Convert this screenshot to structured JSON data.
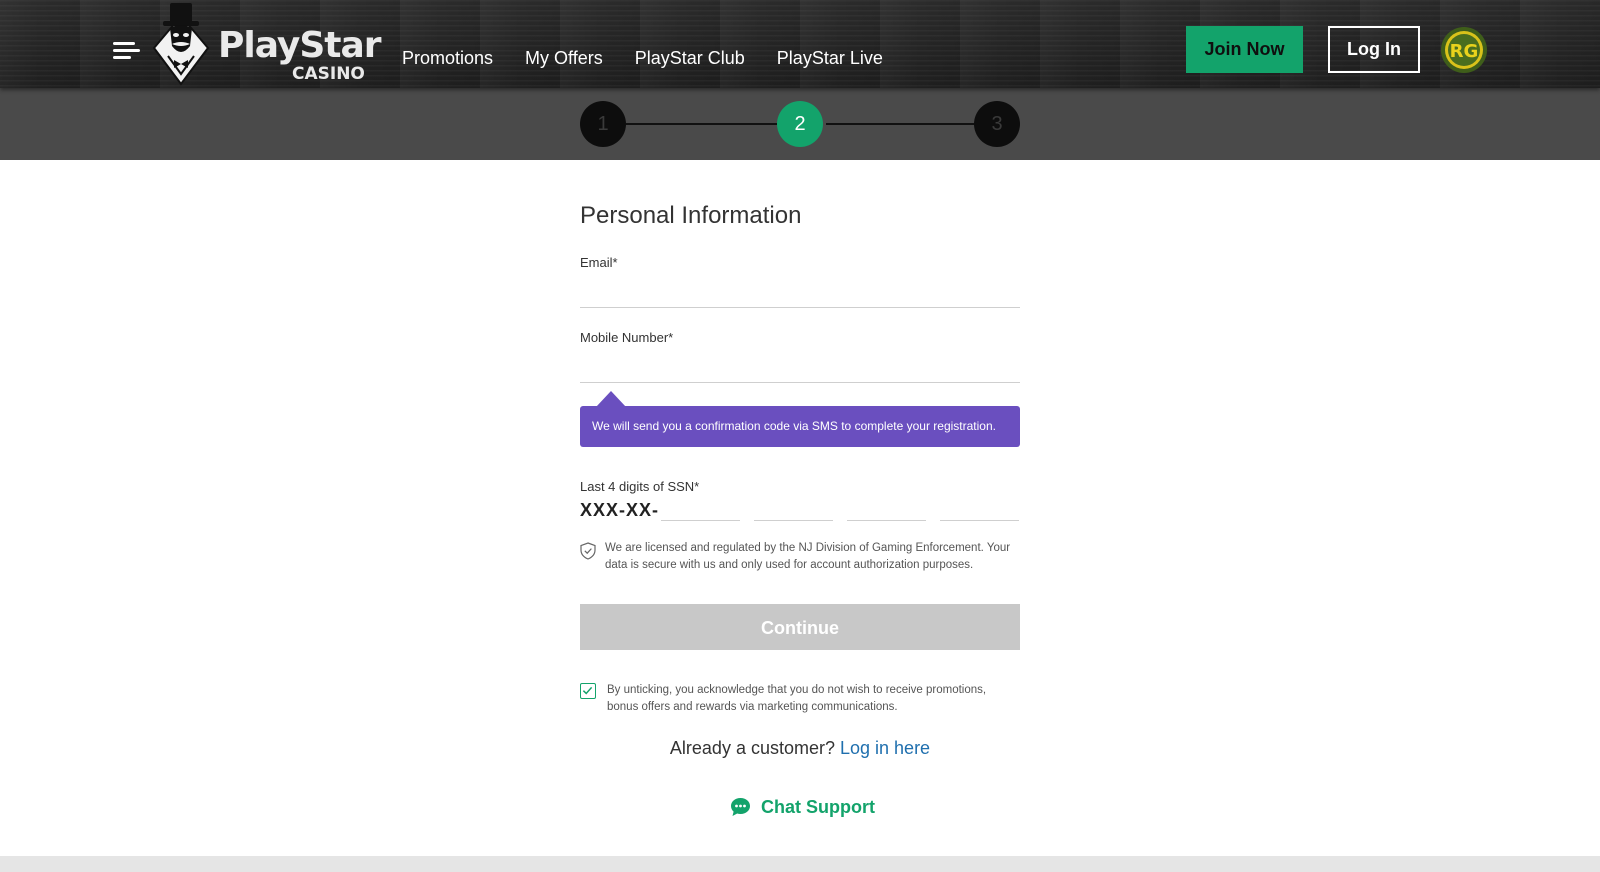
{
  "header": {
    "logo": {
      "word": "PlayStar",
      "sub": "CASINO"
    },
    "nav": [
      {
        "label": "Promotions"
      },
      {
        "label": "My Offers"
      },
      {
        "label": "PlayStar Club"
      },
      {
        "label": "PlayStar Live"
      }
    ],
    "join_label": "Join Now",
    "login_label": "Log In",
    "rg_badge": "RG",
    "colors": {
      "brand_green": "#13a36b",
      "tooltip_purple": "#6a4fbf",
      "link_blue": "#1f6fae"
    }
  },
  "stepper": {
    "steps": [
      "1",
      "2",
      "3"
    ],
    "active_step": 2
  },
  "form": {
    "title": "Personal Information",
    "email": {
      "label": "Email*",
      "value": ""
    },
    "mobile": {
      "label": "Mobile Number*",
      "value": ""
    },
    "sms_notice": "We will send you a confirmation code via SMS to complete your registration.",
    "ssn": {
      "label": "Last 4 digits of SSN*",
      "prefix": "XXX-XX-"
    },
    "secure_note": "We are licensed and regulated by the NJ Division of Gaming Enforcement. Your data is secure with us and only used for account authorization purposes.",
    "continue_label": "Continue",
    "consent": {
      "checked": true,
      "text": "By unticking, you acknowledge that you do not wish to receive promotions, bonus offers and rewards via marketing communications."
    },
    "already_customer": "Already a customer?",
    "login_link": "Log in here",
    "chat_label": "Chat Support"
  },
  "icons": {
    "menu": "hamburger-menu-icon",
    "logo": "top-hat-gentleman-logo",
    "shield": "shield-check-icon",
    "checkbox": "checkmark-icon",
    "chat": "chat-bubble-icon"
  }
}
